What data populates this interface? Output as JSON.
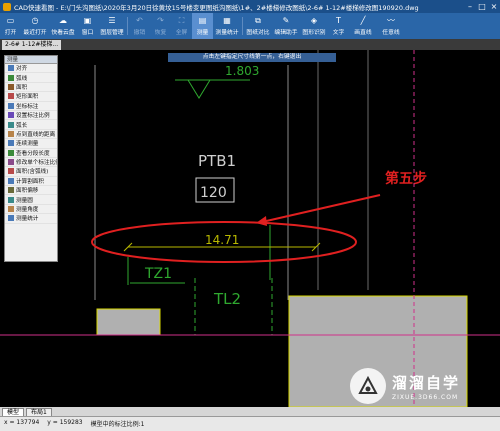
{
  "window": {
    "title": "CAD快速看图 - E:\\门头沟图纸\\2020年3月20日徐黄坟15号楼变更图纸沟图纸\\1#、2#楼梯修改图纸\\2-6# 1-12#楼梯修改图190920.dwg"
  },
  "toolbar": {
    "items": [
      {
        "label": "打开",
        "icon": "folder-open-icon",
        "state": "normal"
      },
      {
        "label": "最近打开",
        "icon": "clock-icon",
        "state": "normal"
      },
      {
        "label": "快看云盘",
        "icon": "cloud-icon",
        "state": "normal"
      },
      {
        "label": "窗口",
        "icon": "window-icon",
        "state": "normal"
      },
      {
        "label": "图层管理",
        "icon": "layers-icon",
        "state": "normal"
      },
      {
        "label": "撤销",
        "icon": "undo-icon",
        "state": "disabled"
      },
      {
        "label": "恢复",
        "icon": "redo-icon",
        "state": "disabled"
      },
      {
        "label": "全屏",
        "icon": "fullscreen-icon",
        "state": "disabled"
      },
      {
        "label": "测量",
        "icon": "ruler-icon",
        "state": "active"
      },
      {
        "label": "测量统计",
        "icon": "ruler-stats-icon",
        "state": "normal"
      },
      {
        "label": "图纸对比",
        "icon": "compare-icon",
        "state": "normal"
      },
      {
        "label": "编辑助手",
        "icon": "edit-icon",
        "state": "normal"
      },
      {
        "label": "图形识别",
        "icon": "shape-recognition-icon",
        "state": "normal"
      },
      {
        "label": "文字",
        "icon": "text-icon",
        "state": "normal"
      },
      {
        "label": "画直线",
        "icon": "line-icon",
        "state": "normal"
      },
      {
        "label": "任意线",
        "icon": "freehand-icon",
        "state": "normal"
      }
    ]
  },
  "document_tab": {
    "label": "2-6# 1-12#楼梯..."
  },
  "hint": {
    "text": "点击左键指定尺寸线第一点，右键退出"
  },
  "palette": {
    "header": "测量",
    "items": [
      {
        "label": "对齐",
        "icon": "align-icon"
      },
      {
        "label": "弧线",
        "icon": "arc-icon"
      },
      {
        "label": "面积",
        "icon": "area-icon"
      },
      {
        "label": "矩形面积",
        "icon": "rect-area-icon"
      },
      {
        "label": "坐标标注",
        "icon": "coordinate-icon"
      },
      {
        "label": "设置标注比例",
        "icon": "scale-icon"
      },
      {
        "label": "弧长",
        "icon": "arc-length-icon"
      },
      {
        "label": "点到直线的距离",
        "icon": "point-line-icon"
      },
      {
        "label": "连续测量",
        "icon": "continuous-icon"
      },
      {
        "label": "查看分段长度",
        "icon": "segment-icon"
      },
      {
        "label": "修改单个标注比例",
        "icon": "edit-scale-icon"
      },
      {
        "label": "面积(含弧线)",
        "icon": "arc-area-icon"
      },
      {
        "label": "计算割面积",
        "icon": "cut-area-icon"
      },
      {
        "label": "面积偏移",
        "icon": "offset-icon"
      },
      {
        "label": "测量圆",
        "icon": "circle-icon"
      },
      {
        "label": "测量角度",
        "icon": "angle-icon"
      },
      {
        "label": "测量统计",
        "icon": "stats-icon"
      }
    ]
  },
  "drawing": {
    "top_label": "1.803",
    "label_ptb1": "PTB1",
    "label_120": "120",
    "dimension_text": "14.71",
    "label_tz1": "TZ1",
    "label_tl2": "TL2"
  },
  "annotation": {
    "step_text": "第五步",
    "color": "#e02020"
  },
  "statusbar": {
    "tabs": [
      "模型",
      "布局1"
    ],
    "x_text": "x = 137794",
    "y_text": "y = 159283",
    "scale_text": "模型中的标注比例:1"
  },
  "watermark": {
    "cn": "溜溜自学",
    "en": "ZIXUE.3D66.COM"
  }
}
